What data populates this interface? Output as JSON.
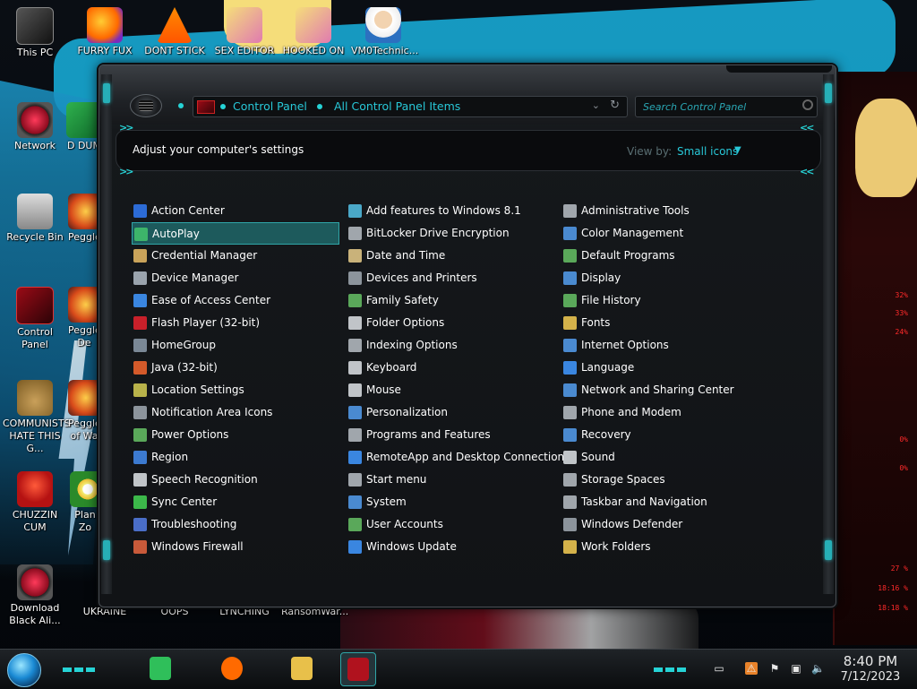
{
  "desktop": {
    "icons": [
      {
        "label": "This PC",
        "icon": "computer-icon"
      },
      {
        "label": "FURRY FUX",
        "icon": "firefox-icon"
      },
      {
        "label": "DONT STICK",
        "icon": "vlc-icon"
      },
      {
        "label": "SEX EDITOR",
        "icon": "image-icon"
      },
      {
        "label": "HOOKED ON",
        "icon": "image-icon"
      },
      {
        "label": "VM0Technic...",
        "icon": "doctor-icon"
      },
      {
        "label": "Network",
        "icon": "network-icon"
      },
      {
        "label": "D DUM",
        "icon": "app-icon"
      },
      {
        "label": "Recycle Bin",
        "icon": "recycle-bin-icon"
      },
      {
        "label": "Peggle",
        "icon": "peggle-icon"
      },
      {
        "label": "Control Panel",
        "icon": "control-panel-icon"
      },
      {
        "label": "Peggle De",
        "icon": "peggle-icon"
      },
      {
        "label": "COMMUNISTS HATE THIS G...",
        "icon": "money-bag-icon"
      },
      {
        "label": "Peggle of Wa",
        "icon": "peggle-icon"
      },
      {
        "label": "CHUZZIN CUM",
        "icon": "chuzzle-icon"
      },
      {
        "label": "Plan Zo",
        "icon": "plants-icon"
      },
      {
        "label": "Download Black Ali...",
        "icon": "network-icon"
      },
      {
        "label": "UKRAINE",
        "icon": "app-icon"
      },
      {
        "label": "OOPS",
        "icon": "app-icon"
      },
      {
        "label": "LYNCHING",
        "icon": "app-icon"
      },
      {
        "label": "RansomWar...",
        "icon": "app-icon"
      }
    ],
    "right_gauges": [
      "32%",
      "33%",
      "24%",
      "0%",
      "0%",
      "27 %",
      "18:16 %",
      "18:18 %"
    ]
  },
  "window": {
    "breadcrumbs": [
      "Control Panel",
      "All Control Panel Items"
    ],
    "search": {
      "placeholder": "Search Control Panel",
      "value": ""
    },
    "header_title": "Adjust your computer's settings",
    "view_by_label": "View by:",
    "view_by_value": "Small icons",
    "accent_color": "#28c8d8",
    "columns": [
      [
        {
          "label": "Action Center",
          "icon": "flag-icon",
          "color": "#2c6bd6"
        },
        {
          "label": "AutoPlay",
          "icon": "autoplay-icon",
          "color": "#3db46a",
          "selected": true
        },
        {
          "label": "Credential Manager",
          "icon": "vault-icon",
          "color": "#c9a35a"
        },
        {
          "label": "Device Manager",
          "icon": "device-manager-icon",
          "color": "#9aa3ad"
        },
        {
          "label": "Ease of Access Center",
          "icon": "ease-of-access-icon",
          "color": "#3a86e0"
        },
        {
          "label": "Flash Player (32-bit)",
          "icon": "flash-icon",
          "color": "#c8202a"
        },
        {
          "label": "HomeGroup",
          "icon": "homegroup-icon",
          "color": "#7a8896"
        },
        {
          "label": "Java (32-bit)",
          "icon": "java-icon",
          "color": "#d45a2a"
        },
        {
          "label": "Location Settings",
          "icon": "location-icon",
          "color": "#b8b24a"
        },
        {
          "label": "Notification Area Icons",
          "icon": "notification-icon",
          "color": "#8c949c"
        },
        {
          "label": "Power Options",
          "icon": "power-icon",
          "color": "#5aa85a"
        },
        {
          "label": "Region",
          "icon": "globe-icon",
          "color": "#3c7ad0"
        },
        {
          "label": "Speech Recognition",
          "icon": "microphone-icon",
          "color": "#c0c4c8"
        },
        {
          "label": "Sync Center",
          "icon": "sync-icon",
          "color": "#3cb84a"
        },
        {
          "label": "Troubleshooting",
          "icon": "troubleshoot-icon",
          "color": "#4a6ec8"
        },
        {
          "label": "Windows Firewall",
          "icon": "firewall-icon",
          "color": "#c85a3a"
        }
      ],
      [
        {
          "label": "Add features to Windows 8.1",
          "icon": "add-features-icon",
          "color": "#4aa8c8"
        },
        {
          "label": "BitLocker Drive Encryption",
          "icon": "bitlocker-icon",
          "color": "#a0a6ac"
        },
        {
          "label": "Date and Time",
          "icon": "clock-icon",
          "color": "#c9b27a"
        },
        {
          "label": "Devices and Printers",
          "icon": "printer-icon",
          "color": "#8c949c"
        },
        {
          "label": "Family Safety",
          "icon": "family-icon",
          "color": "#5aa85a"
        },
        {
          "label": "Folder Options",
          "icon": "folder-options-icon",
          "color": "#c0c4c8"
        },
        {
          "label": "Indexing Options",
          "icon": "indexing-icon",
          "color": "#a0a6ac"
        },
        {
          "label": "Keyboard",
          "icon": "keyboard-icon",
          "color": "#c0c4c8"
        },
        {
          "label": "Mouse",
          "icon": "mouse-icon",
          "color": "#c0c4c8"
        },
        {
          "label": "Personalization",
          "icon": "personalization-icon",
          "color": "#4a8ad0"
        },
        {
          "label": "Programs and Features",
          "icon": "programs-icon",
          "color": "#a0a6ac"
        },
        {
          "label": "RemoteApp and Desktop Connections",
          "icon": "remoteapp-icon",
          "color": "#3a86e0"
        },
        {
          "label": "Start menu",
          "icon": "start-menu-icon",
          "color": "#a0a6ac"
        },
        {
          "label": "System",
          "icon": "system-icon",
          "color": "#4a8ad0"
        },
        {
          "label": "User Accounts",
          "icon": "user-accounts-icon",
          "color": "#5aa85a"
        },
        {
          "label": "Windows Update",
          "icon": "windows-update-icon",
          "color": "#3a86e0"
        }
      ],
      [
        {
          "label": "Administrative Tools",
          "icon": "admin-tools-icon",
          "color": "#a0a6ac"
        },
        {
          "label": "Color Management",
          "icon": "color-management-icon",
          "color": "#4a8ad0"
        },
        {
          "label": "Default Programs",
          "icon": "default-programs-icon",
          "color": "#5aa85a"
        },
        {
          "label": "Display",
          "icon": "display-icon",
          "color": "#4a8ad0"
        },
        {
          "label": "File History",
          "icon": "file-history-icon",
          "color": "#5aa85a"
        },
        {
          "label": "Fonts",
          "icon": "fonts-icon",
          "color": "#d4b24a"
        },
        {
          "label": "Internet Options",
          "icon": "internet-options-icon",
          "color": "#4a8ad0"
        },
        {
          "label": "Language",
          "icon": "language-icon",
          "color": "#3a86e0"
        },
        {
          "label": "Network and Sharing Center",
          "icon": "network-sharing-icon",
          "color": "#4a8ad0"
        },
        {
          "label": "Phone and Modem",
          "icon": "phone-icon",
          "color": "#a0a6ac"
        },
        {
          "label": "Recovery",
          "icon": "recovery-icon",
          "color": "#4a8ad0"
        },
        {
          "label": "Sound",
          "icon": "sound-icon",
          "color": "#c0c4c8"
        },
        {
          "label": "Storage Spaces",
          "icon": "storage-icon",
          "color": "#a0a6ac"
        },
        {
          "label": "Taskbar and Navigation",
          "icon": "taskbar-icon",
          "color": "#a0a6ac"
        },
        {
          "label": "Windows Defender",
          "icon": "defender-icon",
          "color": "#8c949c"
        },
        {
          "label": "Work Folders",
          "icon": "work-folders-icon",
          "color": "#d4b24a"
        }
      ]
    ]
  },
  "taskbar": {
    "pinned": [
      {
        "name": "notes-app-icon",
        "color": "#2fbf5a"
      },
      {
        "name": "firefox-icon",
        "color": "#ff6a00"
      },
      {
        "name": "file-explorer-icon",
        "color": "#e8c04a"
      },
      {
        "name": "control-panel-icon",
        "color": "#b0121e",
        "active": true
      }
    ],
    "tray": [
      "show-hidden-icon",
      "security-icon",
      "flag-icon",
      "network-icon",
      "volume-icon"
    ],
    "time": "8:40 PM",
    "date": "7/12/2023"
  }
}
